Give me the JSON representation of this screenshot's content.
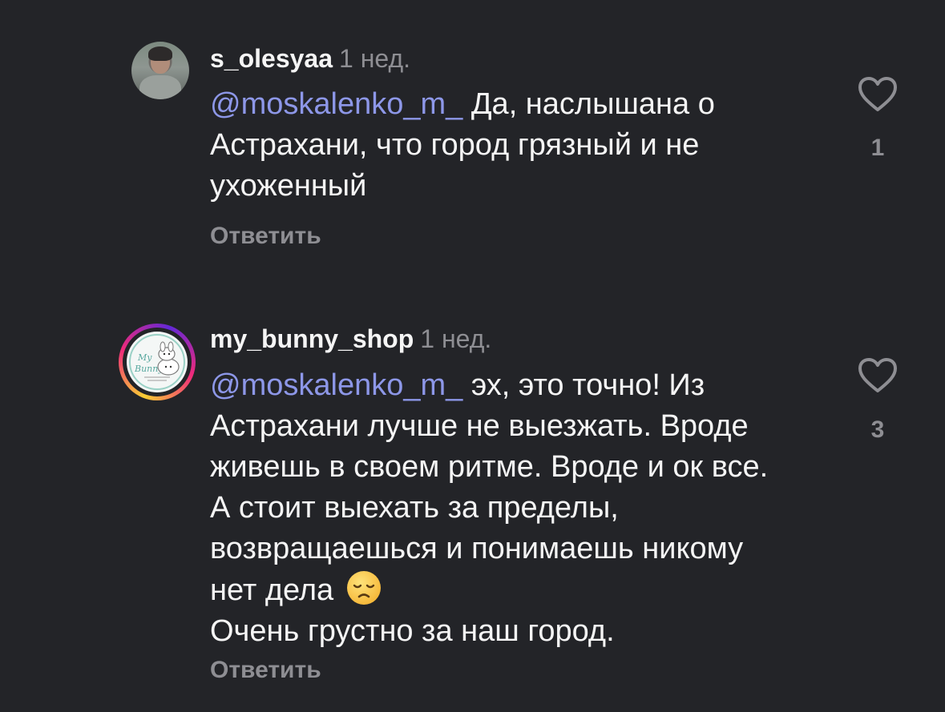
{
  "comments": [
    {
      "username": "s_olesyaa",
      "time": "1 нед.",
      "mention": "@moskalenko_m_",
      "text": " Да, наслышана о Астрахани, что город грязный и не ухоженный",
      "reply_label": "Ответить",
      "like_count": "1",
      "avatar_icon": "user-photo-icon"
    },
    {
      "username": "my_bunny_shop",
      "time": "1 нед.",
      "mention": "@moskalenko_m_",
      "text_before_emoji": " эх, это точно! Из Астрахани лучше не выезжать. Вроде живешь в своем ритме. Вроде и ок все. А стоит выехать за пределы, возвращаешься и понимаешь никому нет дела",
      "emoji": "disappointed-face-emoji",
      "text_after_emoji": "Очень грустно за наш город.",
      "reply_label": "Ответить",
      "like_count": "3",
      "avatar_icon": "bunny-logo-icon",
      "avatar_text": "My Bunny"
    }
  ],
  "colors": {
    "background": "#232428",
    "mention": "#8d97e8",
    "muted": "#8e8e93",
    "text": "#f5f5f5"
  }
}
